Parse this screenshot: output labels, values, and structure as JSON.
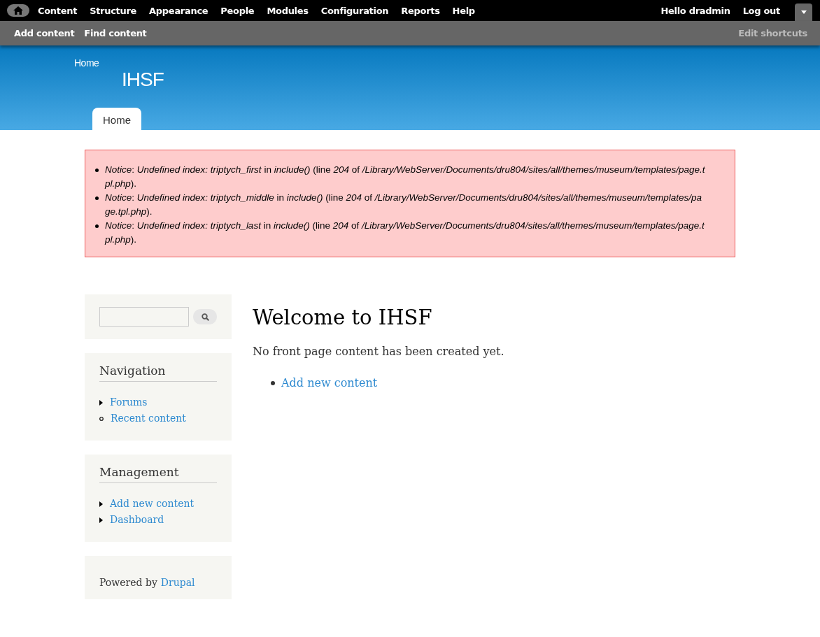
{
  "toolbar": {
    "menu": [
      "Content",
      "Structure",
      "Appearance",
      "People",
      "Modules",
      "Configuration",
      "Reports",
      "Help"
    ],
    "user": "Hello dradmin",
    "logout": "Log out"
  },
  "shortcuts": {
    "items": [
      "Add content",
      "Find content"
    ],
    "edit": "Edit shortcuts"
  },
  "header": {
    "breadcrumb": "Home",
    "site_name": "IHSF",
    "tabs": [
      {
        "label": "Home",
        "selected": true
      }
    ]
  },
  "messages": [
    "*Notice*: *Undefined index: triptych_first* in *include()* (line *204* of */Library/WebServer/Documents/dru804/sites/all/themes/museum/templates/page.tpl.php*).",
    "*Notice*: *Undefined index: triptych_middle* in *include()* (line *204* of */Library/WebServer/Documents/dru804/sites/all/themes/museum/templates/page.tpl.php*).",
    "*Notice*: *Undefined index: triptych_last* in *include()* (line *204* of */Library/WebServer/Documents/dru804/sites/all/themes/museum/templates/page.tpl.php*)."
  ],
  "sidebar": {
    "blocks": [
      {
        "title": "Navigation",
        "items": [
          {
            "label": "Forums",
            "kind": "collapsed"
          },
          {
            "label": "Recent content",
            "kind": "leaf"
          }
        ]
      },
      {
        "title": "Management",
        "items": [
          {
            "label": "Add new content",
            "kind": "collapsed"
          },
          {
            "label": "Dashboard",
            "kind": "collapsed"
          }
        ]
      }
    ],
    "powered_by": "Powered by",
    "powered_link": "Drupal"
  },
  "main": {
    "title": "Welcome to IHSF",
    "text": "No front page content has been created yet.",
    "links": [
      "Add new content"
    ]
  }
}
